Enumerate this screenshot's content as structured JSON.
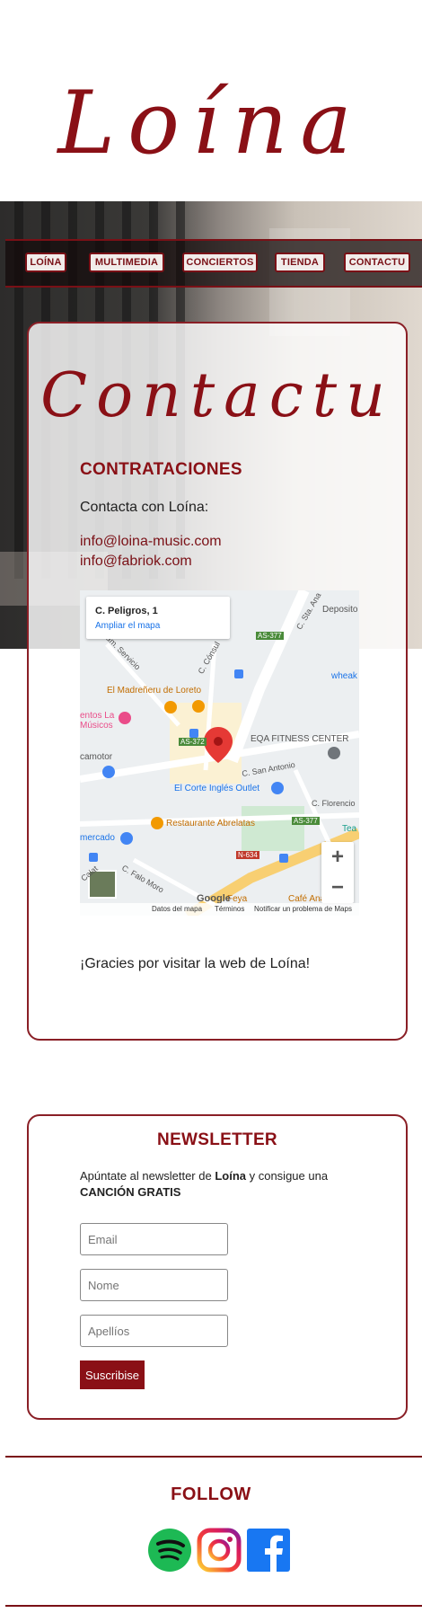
{
  "header": {
    "logo_text": "Loína"
  },
  "nav": {
    "items": [
      "LOÍNA",
      "MULTIMEDIA",
      "CONCIERTOS",
      "TIENDA",
      "CONTACTU"
    ]
  },
  "contact": {
    "title": "Contactu",
    "heading": "CONTRATACIONES",
    "intro": "Contacta con Loína:",
    "emails": [
      "info@loina-music.com",
      "info@fabriok.com"
    ],
    "thanks": "¡Gracies por visitar la web de Loína!"
  },
  "map": {
    "place_title": "C. Peligros, 1",
    "enlarge_link": "Ampliar el mapa",
    "zoom_in": "+",
    "zoom_out": "−",
    "google": "Google",
    "footer": [
      "Datos del mapa",
      "Términos",
      "Notificar un problema de Maps"
    ],
    "labels": {
      "as377_top": "AS-377",
      "sta_ana": "C. Sta. Ana",
      "deposito": "Deposito",
      "serv": "Cam. Servicio",
      "consul": "C. Cónsul",
      "madrenneru": "El Madreñeru de Loreto",
      "musicos": "entos La Músicos",
      "wheak": "wheak",
      "as372": "AS-372",
      "eqa": "EQA FITNESS CENTER",
      "camotor": "camotor",
      "san_antonio": "C. San Antonio",
      "corte_ingles": "El Corte Inglés Outlet",
      "florencio": "C. Florencio",
      "abrelatas": "Restaurante Abrelatas",
      "as377_mid": "AS-377",
      "mercado": "mercado",
      "n634": "N-634",
      "tea": "Tea",
      "calat": "Calat",
      "falo_moro": "C. Falo Moro",
      "feya": "Feya",
      "cafe": "Café Anayba"
    }
  },
  "newsletter": {
    "title": "NEWSLETTER",
    "text_pre": "Apúntate al newsletter de ",
    "text_bold1": "Loína",
    "text_mid": " y consigue una ",
    "text_bold2": "CANCIÓN GRATIS",
    "placeholders": {
      "email": "Email",
      "nome": "Nome",
      "apellios": "Apellíos"
    },
    "button": "Suscribise"
  },
  "footer": {
    "follow": "FOLLOW",
    "social": [
      "spotify-icon",
      "instagram-icon",
      "facebook-icon"
    ]
  },
  "colors": {
    "brand": "#8a1016",
    "map_blue": "#1a73e8",
    "spotify": "#1db954",
    "facebook": "#1877f2"
  }
}
